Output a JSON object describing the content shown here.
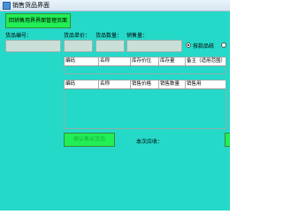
{
  "window": {
    "title": "销售货品界面"
  },
  "toolbar": {
    "return_label": "回销售用界界面管理页面"
  },
  "form": {
    "code_label": "货品编号：",
    "price_label": "货品单价：",
    "qty_label": "货品数量：",
    "sales_qty_label": "销售量：",
    "code_value": "",
    "price_value": "",
    "qty_value": "",
    "sales_qty_value": ""
  },
  "options": {
    "radio1_label": "按款品统"
  },
  "inventory_table": {
    "columns": [
      "编码",
      "名称",
      "库存价位",
      "库存量",
      "备主（适用范围）"
    ]
  },
  "sales_table": {
    "columns": [
      "编码",
      "名称",
      "销售价格",
      "销售数量",
      "销售用"
    ]
  },
  "footer": {
    "confirm_label": "确认售出货品",
    "total_label": "本次应收："
  }
}
